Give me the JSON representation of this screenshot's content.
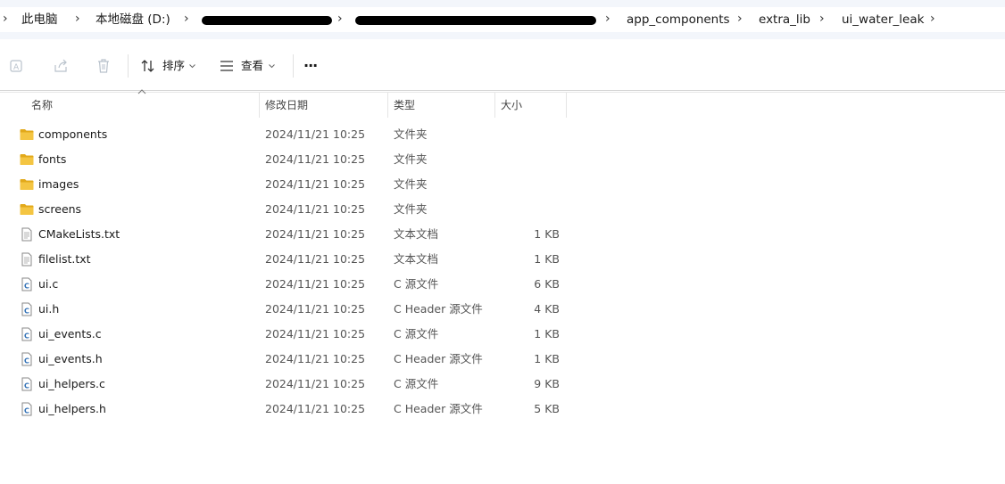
{
  "breadcrumb": {
    "items": [
      {
        "label": "此电脑"
      },
      {
        "label": "本地磁盘 (D:)"
      },
      {
        "label": ""
      },
      {
        "label": ""
      },
      {
        "label": "app_components"
      },
      {
        "label": "extra_lib"
      },
      {
        "label": "ui_water_leak"
      }
    ]
  },
  "toolbar": {
    "sort_label": "排序",
    "view_label": "查看",
    "more_label": "···"
  },
  "columns": {
    "name": "名称",
    "modified": "修改日期",
    "type": "类型",
    "size": "大小"
  },
  "files": [
    {
      "name": "components",
      "modified": "2024/11/21 10:25",
      "type": "文件夹",
      "size": "",
      "icon": "folder-icon"
    },
    {
      "name": "fonts",
      "modified": "2024/11/21 10:25",
      "type": "文件夹",
      "size": "",
      "icon": "folder-icon"
    },
    {
      "name": "images",
      "modified": "2024/11/21 10:25",
      "type": "文件夹",
      "size": "",
      "icon": "folder-icon"
    },
    {
      "name": "screens",
      "modified": "2024/11/21 10:25",
      "type": "文件夹",
      "size": "",
      "icon": "folder-icon"
    },
    {
      "name": "CMakeLists.txt",
      "modified": "2024/11/21 10:25",
      "type": "文本文档",
      "size": "1 KB",
      "icon": "text-file-icon"
    },
    {
      "name": "filelist.txt",
      "modified": "2024/11/21 10:25",
      "type": "文本文档",
      "size": "1 KB",
      "icon": "text-file-icon"
    },
    {
      "name": "ui.c",
      "modified": "2024/11/21 10:25",
      "type": "C 源文件",
      "size": "6 KB",
      "icon": "c-source-file-icon"
    },
    {
      "name": "ui.h",
      "modified": "2024/11/21 10:25",
      "type": "C Header 源文件",
      "size": "4 KB",
      "icon": "c-header-file-icon"
    },
    {
      "name": "ui_events.c",
      "modified": "2024/11/21 10:25",
      "type": "C 源文件",
      "size": "1 KB",
      "icon": "c-source-file-icon"
    },
    {
      "name": "ui_events.h",
      "modified": "2024/11/21 10:25",
      "type": "C Header 源文件",
      "size": "1 KB",
      "icon": "c-header-file-icon"
    },
    {
      "name": "ui_helpers.c",
      "modified": "2024/11/21 10:25",
      "type": "C 源文件",
      "size": "9 KB",
      "icon": "c-source-file-icon"
    },
    {
      "name": "ui_helpers.h",
      "modified": "2024/11/21 10:25",
      "type": "C Header 源文件",
      "size": "5 KB",
      "icon": "c-header-file-icon"
    }
  ],
  "colors": {
    "folder": "#f4c542",
    "folder_dark": "#e2a91a",
    "c_file_accent": "#2f6fb5",
    "breadcrumb_bg": "#f3f6fb"
  }
}
